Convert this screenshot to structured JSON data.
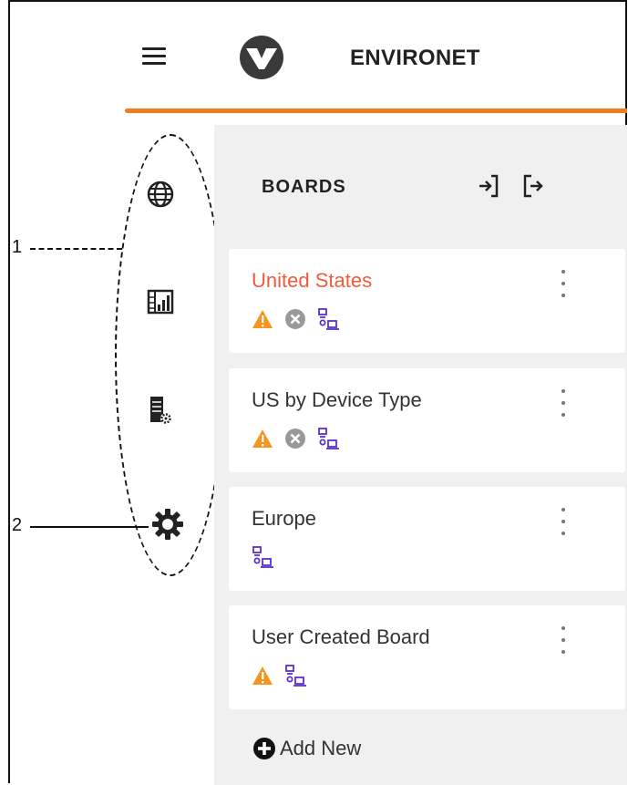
{
  "header": {
    "app_title": "ENVIRONET",
    "brand_color": "#f47a20",
    "menu_icon": "hamburger-menu-icon",
    "logo_icon": "vertiv-logo-icon"
  },
  "sidebar": {
    "items": [
      {
        "name": "globe-icon"
      },
      {
        "name": "dashboard-chart-icon"
      },
      {
        "name": "server-settings-icon"
      },
      {
        "name": "gear-icon"
      }
    ]
  },
  "annotations": {
    "label_1": "1",
    "label_2": "2"
  },
  "boards": {
    "title": "BOARDS",
    "expand_icon": "expand-all-icon",
    "collapse_icon": "collapse-all-icon",
    "items": [
      {
        "title": "United States",
        "title_color": "#f15a3a",
        "warning": true,
        "error": true,
        "devices": true
      },
      {
        "title": "US by Device Type",
        "warning": true,
        "error": true,
        "devices": true
      },
      {
        "title": "Europe",
        "warning": false,
        "error": false,
        "devices": true
      },
      {
        "title": "User Created Board",
        "warning": true,
        "error": false,
        "devices": true
      }
    ],
    "add_new_label": "Add New",
    "colors": {
      "warning": "#f7941d",
      "error": "#999999",
      "devices": "#5a2fd3"
    }
  }
}
